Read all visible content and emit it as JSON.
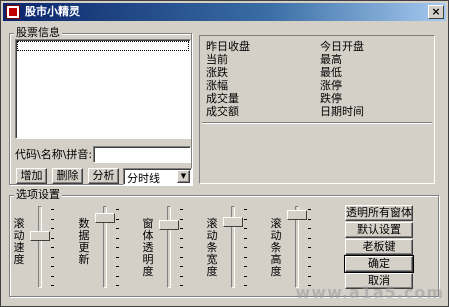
{
  "window": {
    "title": "股市小精灵",
    "close_glyph": "×"
  },
  "stock_info": {
    "group_label": "股票信息",
    "code_label": "代码\\名称\\拼音:",
    "code_value": "",
    "buttons": {
      "add": "增加",
      "delete": "删除",
      "analyze": "分析"
    },
    "chart_select": {
      "value": "分时线",
      "arrow": "▼"
    }
  },
  "quote_panel": {
    "left_col": [
      "昨日收盘",
      "当前",
      "涨跌",
      "涨幅",
      "成交量",
      "成交额"
    ],
    "right_col": [
      "今日开盘",
      "最高",
      "最低",
      "涨停",
      "跌停",
      "日期时间"
    ]
  },
  "options": {
    "group_label": "选项设置",
    "sliders": [
      {
        "label": "滚动速度",
        "level": 0.35
      },
      {
        "label": "数据更新",
        "level": 0.1
      },
      {
        "label": "窗体透明度",
        "level": 0.2
      },
      {
        "label": "滚动条宽度",
        "level": 0.15
      },
      {
        "label": "滚动条高度",
        "level": 0.05
      }
    ],
    "buttons": {
      "transparent_all": "透明所有窗体",
      "defaults": "默认设置",
      "boss_key": "老板键",
      "ok": "确定",
      "cancel": "取消"
    }
  },
  "watermark": "www.a1a5.com"
}
